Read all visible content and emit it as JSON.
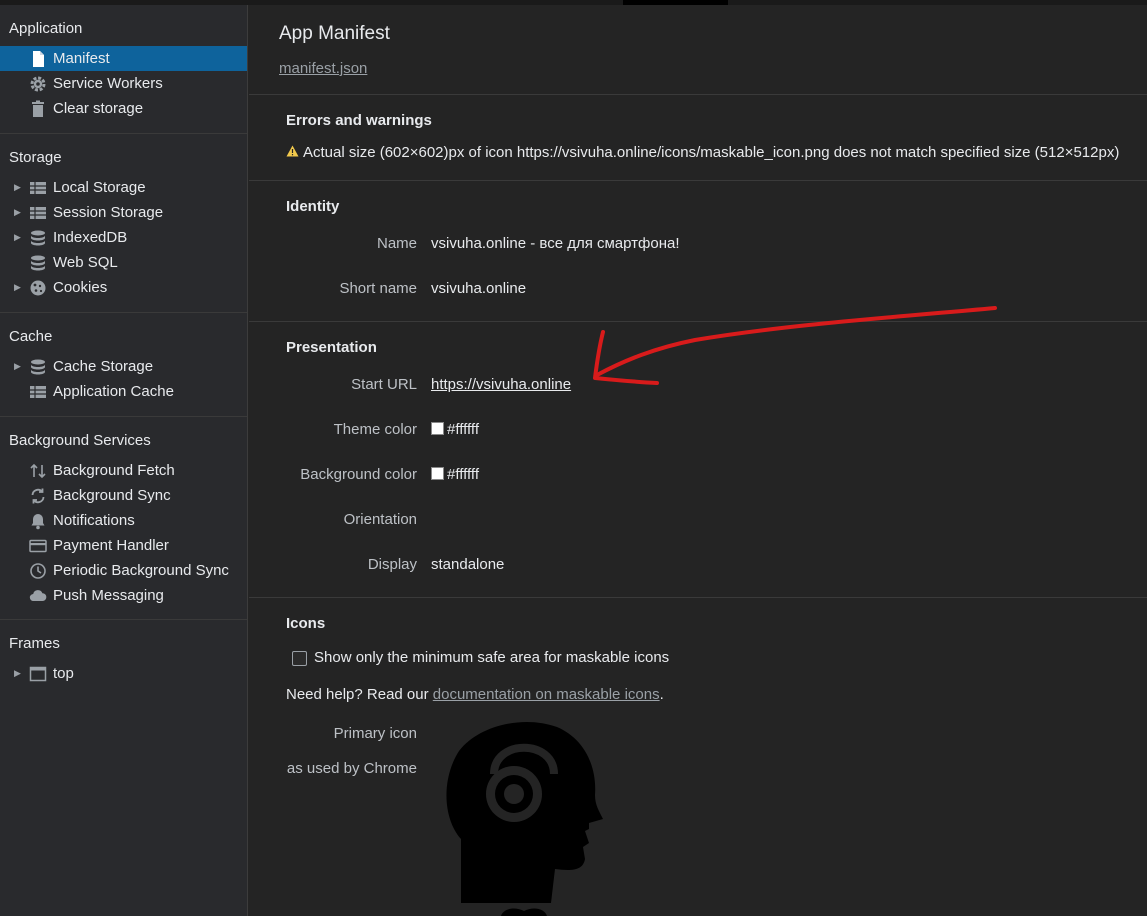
{
  "sidebar": {
    "sections": [
      {
        "title": "Application",
        "items": [
          {
            "label": "Manifest",
            "icon": "file-icon"
          },
          {
            "label": "Service Workers",
            "icon": "gear-icon"
          },
          {
            "label": "Clear storage",
            "icon": "trash-icon"
          }
        ]
      },
      {
        "title": "Storage",
        "items": [
          {
            "label": "Local Storage",
            "icon": "grid-icon"
          },
          {
            "label": "Session Storage",
            "icon": "grid-icon"
          },
          {
            "label": "IndexedDB",
            "icon": "database-icon"
          },
          {
            "label": "Web SQL",
            "icon": "database-icon"
          },
          {
            "label": "Cookies",
            "icon": "cookie-icon"
          }
        ]
      },
      {
        "title": "Cache",
        "items": [
          {
            "label": "Cache Storage",
            "icon": "database-icon"
          },
          {
            "label": "Application Cache",
            "icon": "grid-icon"
          }
        ]
      },
      {
        "title": "Background Services",
        "items": [
          {
            "label": "Background Fetch",
            "icon": "arrows-updown-icon"
          },
          {
            "label": "Background Sync",
            "icon": "sync-icon"
          },
          {
            "label": "Notifications",
            "icon": "bell-icon"
          },
          {
            "label": "Payment Handler",
            "icon": "card-icon"
          },
          {
            "label": "Periodic Background Sync",
            "icon": "clock-icon"
          },
          {
            "label": "Push Messaging",
            "icon": "cloud-icon"
          }
        ]
      },
      {
        "title": "Frames",
        "items": [
          {
            "label": "top",
            "icon": "window-icon"
          }
        ]
      }
    ]
  },
  "main": {
    "title": "App Manifest",
    "manifest_link": "manifest.json",
    "errors": {
      "heading": "Errors and warnings",
      "warning": "Actual size (602×602)px of icon https://vsivuha.online/icons/maskable_icon.png does not match specified size (512×512px)"
    },
    "identity": {
      "heading": "Identity",
      "name_label": "Name",
      "name_value": "vsivuha.online - все для смартфона!",
      "short_name_label": "Short name",
      "short_name_value": "vsivuha.online"
    },
    "presentation": {
      "heading": "Presentation",
      "start_url_label": "Start URL",
      "start_url_value": "https://vsivuha.online",
      "theme_color_label": "Theme color",
      "theme_color_value": "#ffffff",
      "background_color_label": "Background color",
      "background_color_value": "#ffffff",
      "orientation_label": "Orientation",
      "display_label": "Display",
      "display_value": "standalone"
    },
    "icons": {
      "heading": "Icons",
      "checkbox_label": "Show only the minimum safe area for maskable icons",
      "help_prefix": "Need help? Read our ",
      "help_link": "documentation on maskable icons",
      "help_suffix": ".",
      "primary_icon_label": "Primary icon",
      "primary_icon_sublabel": "as used by Chrome"
    }
  },
  "colors": {
    "selected": "#0e639c",
    "annotation_arrow": "#d81b1b"
  }
}
